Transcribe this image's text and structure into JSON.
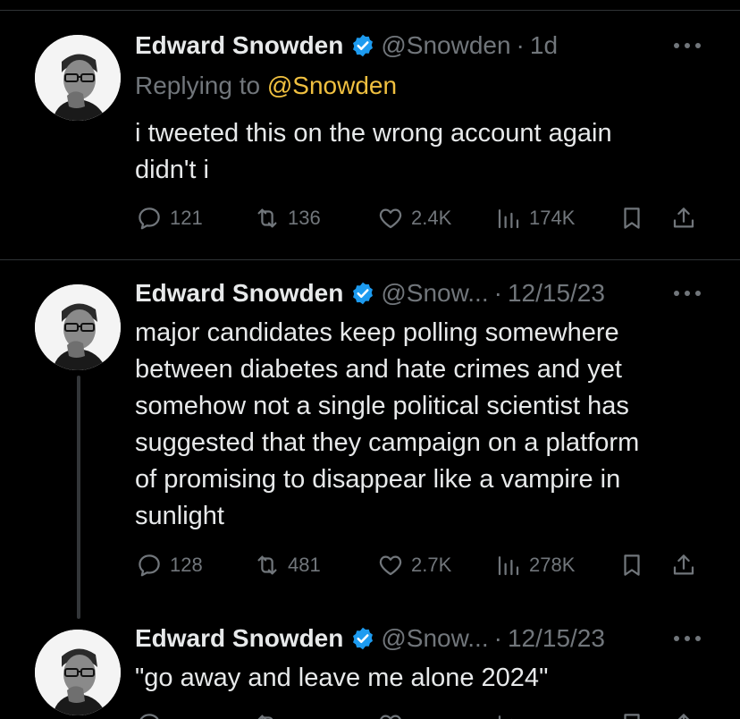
{
  "tweets": [
    {
      "name": "Edward Snowden",
      "handle": "@Snowden",
      "dot": "·",
      "time": "1d",
      "reply_prefix": "Replying to",
      "reply_mention": "@Snowden",
      "text": "i tweeted this on the wrong account again\ndidn't i",
      "stats": {
        "replies": "121",
        "reposts": "136",
        "likes": "2.4K",
        "views": "174K"
      }
    },
    {
      "name": "Edward Snowden",
      "handle": "@Snow...",
      "dot": "·",
      "time": "12/15/23",
      "text": "major candidates keep polling somewhere\nbetween diabetes and hate crimes and yet\nsomehow not a single political scientist has\nsuggested that they campaign on a platform\nof promising to disappear like a vampire in\nsunlight",
      "stats": {
        "replies": "128",
        "reposts": "481",
        "likes": "2.7K",
        "views": "278K"
      }
    },
    {
      "name": "Edward Snowden",
      "handle": "@Snow...",
      "dot": "·",
      "time": "12/15/23",
      "text": "\"go away and leave me alone 2024\""
    }
  ],
  "icons": {
    "verified": "verified-badge-icon",
    "more": "more-options-icon",
    "reply": "reply-icon",
    "repost": "repost-icon",
    "like": "heart-icon",
    "views": "views-icon",
    "bookmark": "bookmark-icon",
    "share": "share-icon"
  },
  "colors": {
    "verified": "#1d9bf0",
    "mention": "#f0c040",
    "muted": "#71767b",
    "text": "#e7e9ea"
  }
}
